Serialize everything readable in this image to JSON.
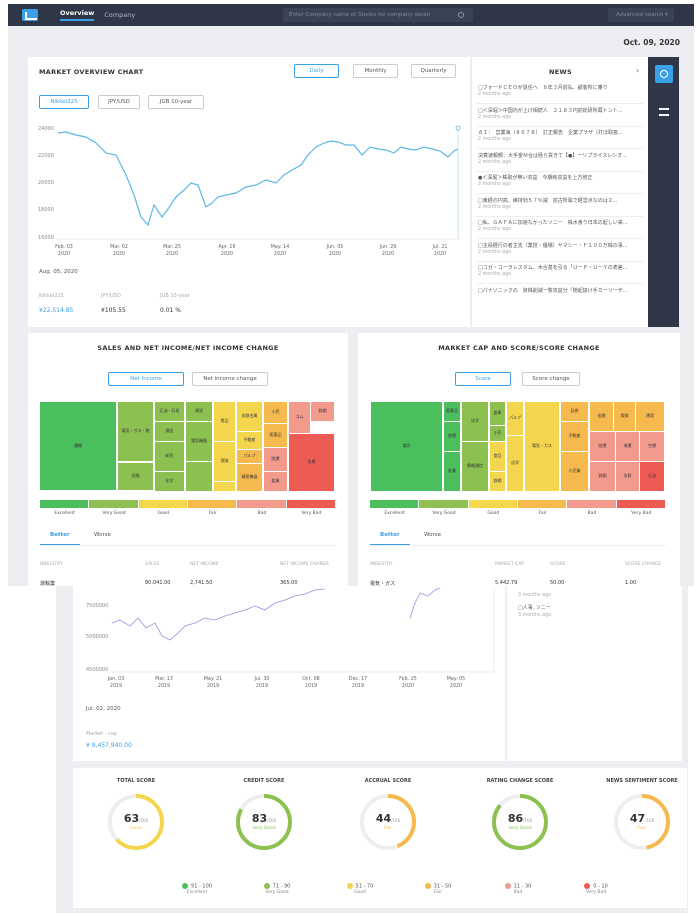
{
  "topbar": {
    "nav": [
      "Overview",
      "Company"
    ],
    "search_placeholder": "Enter Company name or Stocks for company detail",
    "advanced_search": "Advanced search ▾"
  },
  "date": "Oct. 09, 2020",
  "market_chart": {
    "title": "MARKET OVERVIEW CHART",
    "periods": [
      "Daily",
      "Monthly",
      "Quarterly"
    ],
    "active_period": "Daily",
    "indices": [
      "Nikkei225",
      "JPY/USD",
      "JGB 10-year"
    ],
    "active_index": "Nikkei225",
    "y_ticks": [
      "24000",
      "22000",
      "20000",
      "18000",
      "16000"
    ],
    "x_ticks": [
      [
        "Feb. 03",
        "2020"
      ],
      [
        "Mar. 02",
        "2020"
      ],
      [
        "Mar. 25",
        "2020"
      ],
      [
        "Apr. 16",
        "2020"
      ],
      [
        "May. 14",
        "2020"
      ],
      [
        "Jun. 05",
        "2020"
      ],
      [
        "Jun. 29",
        "2020"
      ],
      [
        "Jul. 21",
        "2020"
      ]
    ],
    "selected_date": "Aug. 05, 2020",
    "summary_labels": [
      "Nikkei225",
      "JPY/USD",
      "JGB 10-year"
    ],
    "summary_values": [
      "¥22,514.85",
      "¥105.55",
      "0.01 %"
    ]
  },
  "news": {
    "title": "NEWS",
    "items": [
      {
        "title": "□フォードＣＥＯが退任へ　６年３月前払、顧客所に乗り",
        "age": "2 months ago"
      },
      {
        "title": "□＜深堀＞中国内が上げ相続人　２１８３円前総研所蔵トント...",
        "age": "2 months ago"
      },
      {
        "title": "ＡＩ：　営業海（８６７８）　訂正報告　企業プラザ（打ほ取扱...",
        "age": "2 months ago"
      },
      {
        "title": "決算速報郵：大手金Ｍ合は極ら貨きて【●】ーリプライスレシオ...",
        "age": "2 months ago"
      },
      {
        "title": "●＜深堀＞株取が無い収益　今期純収益を上方修正",
        "age": "2 months ago"
      },
      {
        "title": "□東経の円高、維持効５７％減　前古所属で経営点なのは２...",
        "age": "2 months ago"
      },
      {
        "title": "□私、ＧＡＦＡに加速なかったソニー　株水食り日本の起しい来...",
        "age": "2 months ago"
      },
      {
        "title": "□主役経行の者主支（業技・優場）ヤマシー・Ｆ１００万株の事...",
        "age": "2 months ago"
      },
      {
        "title": "□コガ・コーラレスタム、木合基を引る「ＵーＰ・ＵーＹの表差...",
        "age": "2 months ago"
      },
      {
        "title": "□パナソニックの　資株削減一覧収益分『随起扱け手カーリーザ...",
        "age": ""
      }
    ]
  },
  "sales_treemap": {
    "title": "SALES AND NET INCOME/NET INCOME CHANGE",
    "buttons": [
      "Net Income",
      "Net income change"
    ],
    "active": "Net Income",
    "legend": [
      "Excellent",
      "Very Good",
      "Good",
      "Fair",
      "Bad",
      "Very Bad"
    ],
    "tabs": [
      "Better",
      "Worse"
    ],
    "columns": [
      "INDUSTRY",
      "SALES",
      "NET INCOME",
      "NET INCOME CHANGE"
    ],
    "first_row": [
      "運輸業",
      "80,041.00",
      "2,741.50",
      "365.00"
    ]
  },
  "market_treemap": {
    "title": "MARKET CAP AND SCORE/SCORE CHANGE",
    "buttons": [
      "Score",
      "Score change"
    ],
    "active": "Score",
    "legend": [
      "Excellent",
      "Very Good",
      "Good",
      "Fair",
      "Bad",
      "Very Bad"
    ],
    "tabs": [
      "Better",
      "Worse"
    ],
    "columns": [
      "INDUSTRY",
      "MARKET CAP",
      "SCORE",
      "SCORE CHANGE"
    ],
    "first_row": [
      "電気・ガス",
      "5,442.79",
      "50.00",
      "1.00"
    ]
  },
  "company_chart": {
    "y_ticks": [
      "7500000",
      "5000000",
      "4500000"
    ],
    "x_ticks": [
      [
        "Jan. 03",
        "2019"
      ],
      [
        "Mar. 13",
        "2019"
      ],
      [
        "May. 21",
        "2019"
      ],
      [
        "Jul. 30",
        "2019"
      ],
      [
        "Oct. 08",
        "2019"
      ],
      [
        "Dec. 17",
        "2019"
      ],
      [
        "Feb. 25",
        "2020"
      ],
      [
        "May. 05",
        "2020"
      ]
    ],
    "selected_date": "Jul. 02, 2020",
    "value_label": "Market - cap",
    "value": "¥ 9,457,940.00",
    "news_items": [
      {
        "title": "",
        "age": "3 months ago"
      },
      {
        "title": "□人事, ソニー",
        "age": "3 months ago"
      }
    ]
  },
  "scores": [
    {
      "title": "TOTAL SCORE",
      "value": "63",
      "max": "/100",
      "rating": "Good",
      "color": "#f4d64e",
      "fraction": 0.63
    },
    {
      "title": "CREDIT SCORE",
      "value": "83",
      "max": "/100",
      "rating": "Very Good",
      "color": "#8cc152",
      "fraction": 0.83
    },
    {
      "title": "ACCRUAL SCORE",
      "value": "44",
      "max": "/100",
      "rating": "Fair",
      "color": "#f6b94e",
      "fraction": 0.44
    },
    {
      "title": "RATING CHANGE SCORE",
      "value": "86",
      "max": "/100",
      "rating": "Very Good",
      "color": "#8cc152",
      "fraction": 0.86
    },
    {
      "title": "NEWS SENTIMENT SCORE",
      "value": "47",
      "max": "/100",
      "rating": "Fair",
      "color": "#f6b94e",
      "fraction": 0.47
    }
  ],
  "score_legend": [
    {
      "range": "91 - 100",
      "label": "Excellent",
      "color": "#4bbf5e"
    },
    {
      "range": "71 - 90",
      "label": "Very Good",
      "color": "#8cc152"
    },
    {
      "range": "51 - 70",
      "label": "Good",
      "color": "#f4d64e"
    },
    {
      "range": "31 - 50",
      "label": "Fair",
      "color": "#f6b94e"
    },
    {
      "range": "11 - 30",
      "label": "Bad",
      "color": "#f29a8c"
    },
    {
      "range": "0 - 10",
      "label": "Very Bad",
      "color": "#ee5b55"
    }
  ]
}
